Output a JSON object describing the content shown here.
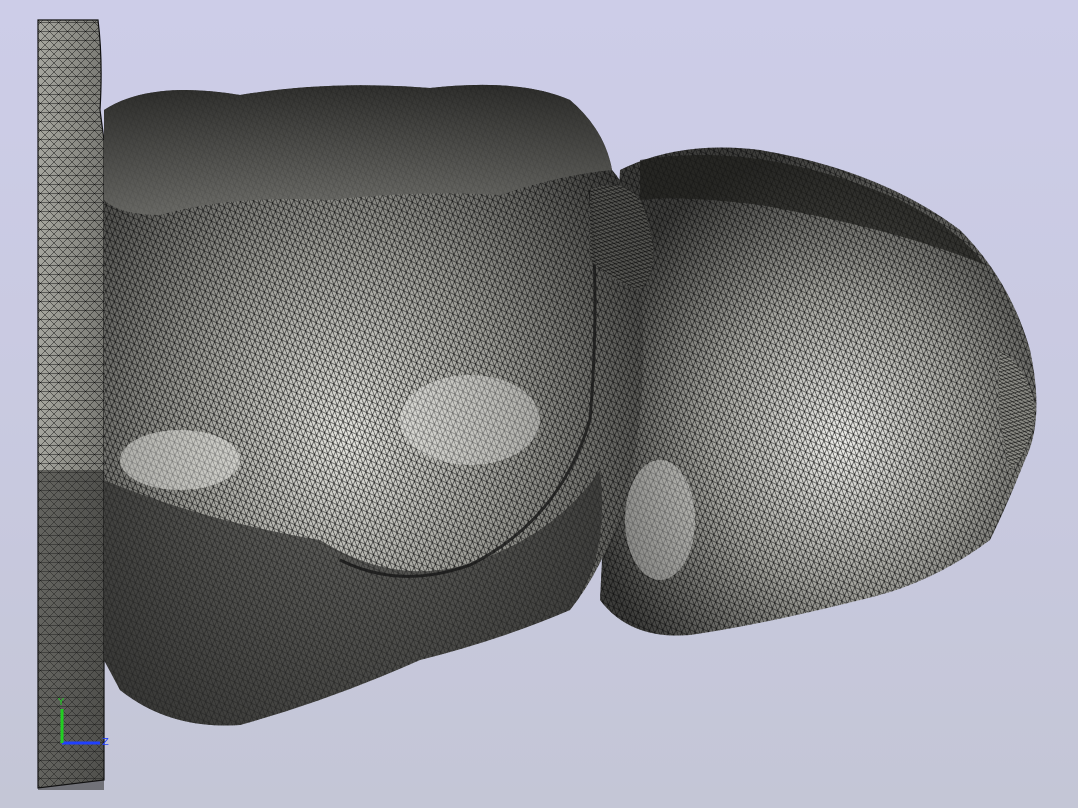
{
  "viewport": {
    "background_top": "#cdcde8",
    "background_bottom": "#c4c6d6",
    "render_mode": "wireframe mesh",
    "mesh_fill": "#8c8c86",
    "mesh_edge": "#1a1a1a"
  },
  "triad": {
    "x_axis_color": "#e02020",
    "y_axis_color": "#20d020",
    "z_axis_color": "#2040ff",
    "y_label": "Y",
    "z_label": "Z"
  }
}
